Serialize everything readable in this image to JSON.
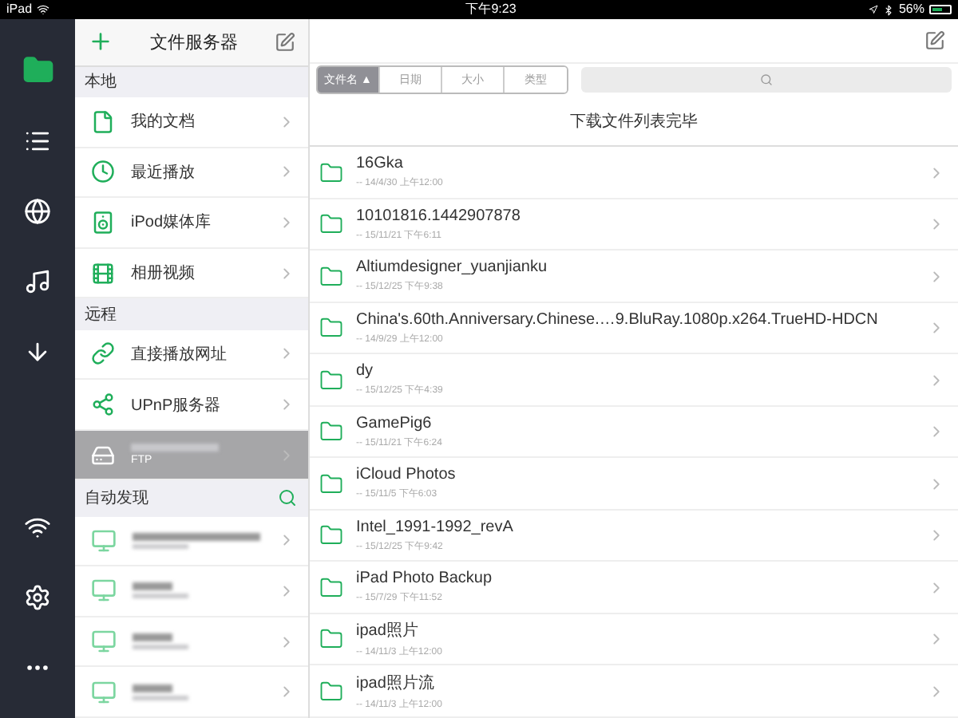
{
  "status_bar": {
    "device": "iPad",
    "time": "下午9:23",
    "battery": "56%"
  },
  "rail": [
    {
      "kind": "folder",
      "selected": true
    },
    {
      "kind": "list",
      "selected": false
    },
    {
      "kind": "globe",
      "selected": false
    },
    {
      "kind": "music",
      "selected": false
    },
    {
      "kind": "download",
      "selected": false
    }
  ],
  "rail_bottom": [
    {
      "kind": "wifi"
    },
    {
      "kind": "settings"
    },
    {
      "kind": "more"
    }
  ],
  "sidebar": {
    "title": "文件服务器",
    "sections": [
      {
        "title": "本地",
        "items": [
          {
            "kind": "document",
            "label": "我的文档",
            "selected": false
          },
          {
            "kind": "clock",
            "label": "最近播放",
            "selected": false
          },
          {
            "kind": "speaker",
            "label": "iPod媒体库",
            "selected": false
          },
          {
            "kind": "film",
            "label": "相册视频",
            "selected": false
          }
        ]
      },
      {
        "title": "远程",
        "items": [
          {
            "kind": "link",
            "label": "直接播放网址",
            "selected": false
          },
          {
            "kind": "upnp",
            "label": "UPnP服务器",
            "selected": false
          },
          {
            "kind": "server",
            "label": "FTP",
            "blurred": true,
            "selected": true
          }
        ]
      }
    ],
    "discovery": {
      "title": "自动发现",
      "devices": [
        {
          "kind": "monitor"
        },
        {
          "kind": "monitor"
        },
        {
          "kind": "monitor"
        },
        {
          "kind": "monitor"
        }
      ]
    }
  },
  "sort_tabs": [
    {
      "label": "文件名 ▲",
      "selected": true
    },
    {
      "label": "日期",
      "selected": false
    },
    {
      "label": "大小",
      "selected": false
    },
    {
      "label": "类型",
      "selected": false
    }
  ],
  "message": "下载文件列表完毕",
  "files": [
    {
      "name": "16Gka",
      "date": "-- 14/4/30 上午12:00"
    },
    {
      "name": "10101816.1442907878",
      "date": "-- 15/11/21 下午6:11"
    },
    {
      "name": "Altiumdesigner_yuanjianku",
      "date": "-- 15/12/25 下午9:38"
    },
    {
      "name": "China's.60th.Anniversary.Chinese.…9.BluRay.1080p.x264.TrueHD-HDCN",
      "date": "-- 14/9/29 上午12:00"
    },
    {
      "name": "dy",
      "date": "-- 15/12/25 下午4:39"
    },
    {
      "name": "GamePig6",
      "date": "-- 15/11/21 下午6:24"
    },
    {
      "name": "iCloud Photos",
      "date": "-- 15/11/5 下午6:03"
    },
    {
      "name": "Intel_1991-1992_revA",
      "date": "-- 15/12/25 下午9:42"
    },
    {
      "name": "iPad Photo Backup",
      "date": "-- 15/7/29 下午11:52"
    },
    {
      "name": "ipad照片",
      "date": "-- 14/11/3 上午12:00"
    },
    {
      "name": "ipad照片流",
      "date": "-- 14/11/3 上午12:00"
    }
  ]
}
